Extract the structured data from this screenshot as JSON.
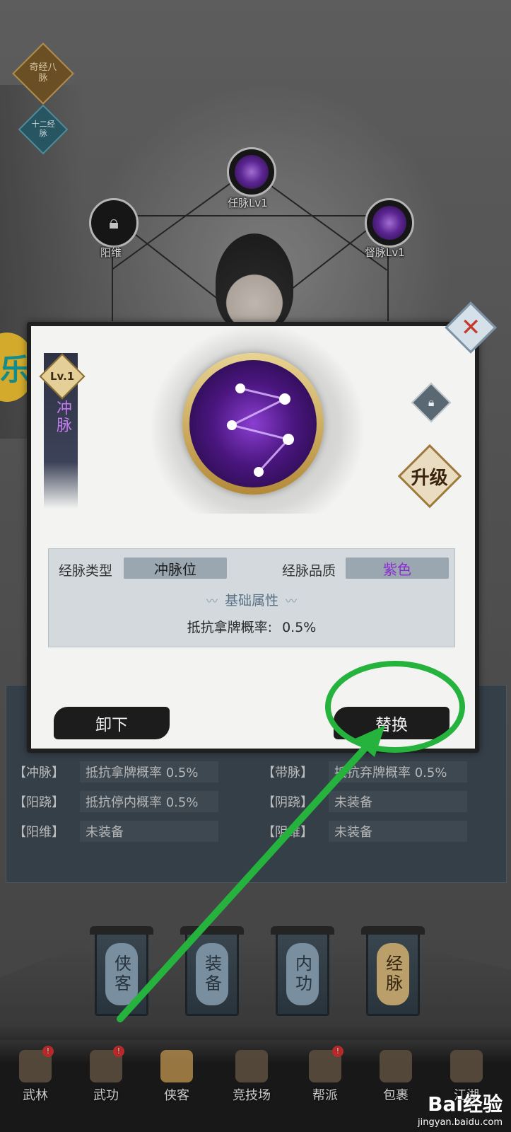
{
  "badges": {
    "qijing": "奇经八脉",
    "shier": "十二经脉"
  },
  "nodes": {
    "renmai": "任脉Lv1",
    "yangwei": "阳维",
    "dumai": "督脉Lv1"
  },
  "event_icon": "乐",
  "equip_list": {
    "rows": [
      {
        "tag": "【冲脉】",
        "value": "抵抗拿牌概率 0.5%"
      },
      {
        "tag": "【阳跷】",
        "value": "抵抗停内概率 0.5%"
      },
      {
        "tag": "【阳维】",
        "value": "未装备"
      },
      {
        "tag": "【带脉】",
        "value": "抵抗弃牌概率 0.5%"
      },
      {
        "tag": "【阴跷】",
        "value": "未装备"
      },
      {
        "tag": "【阴维】",
        "value": "未装备"
      }
    ]
  },
  "pillars": [
    {
      "label": "侠客"
    },
    {
      "label": "装备"
    },
    {
      "label": "内功"
    },
    {
      "label": "经脉"
    }
  ],
  "nav": [
    {
      "label": "武林",
      "icon": "pagoda-icon"
    },
    {
      "label": "武功",
      "icon": "scroll-icon"
    },
    {
      "label": "侠客",
      "icon": "hat-icon"
    },
    {
      "label": "竞技场",
      "icon": "swords-icon"
    },
    {
      "label": "帮派",
      "icon": "flag-icon"
    },
    {
      "label": "包裹",
      "icon": "bag-icon"
    },
    {
      "label": "江湖",
      "icon": "mountain-icon"
    }
  ],
  "dialog": {
    "level": "Lv.1",
    "vein_name": "冲脉",
    "upgrade_label": "升级",
    "type_label": "经脉类型",
    "type_value": "冲脉位",
    "quality_label": "经脉品质",
    "quality_value": "紫色",
    "section_title": "基础属性",
    "attr_label": "抵抗拿牌概率:",
    "attr_value": "0.5%",
    "unequip_label": "卸下",
    "replace_label": "替换",
    "close_symbol": "✕"
  },
  "watermark": {
    "brand": "Bai经验",
    "url": "jingyan.baidu.com"
  },
  "colors": {
    "annotation": "#25b33d",
    "quality_purple": "#8a2bd0"
  }
}
